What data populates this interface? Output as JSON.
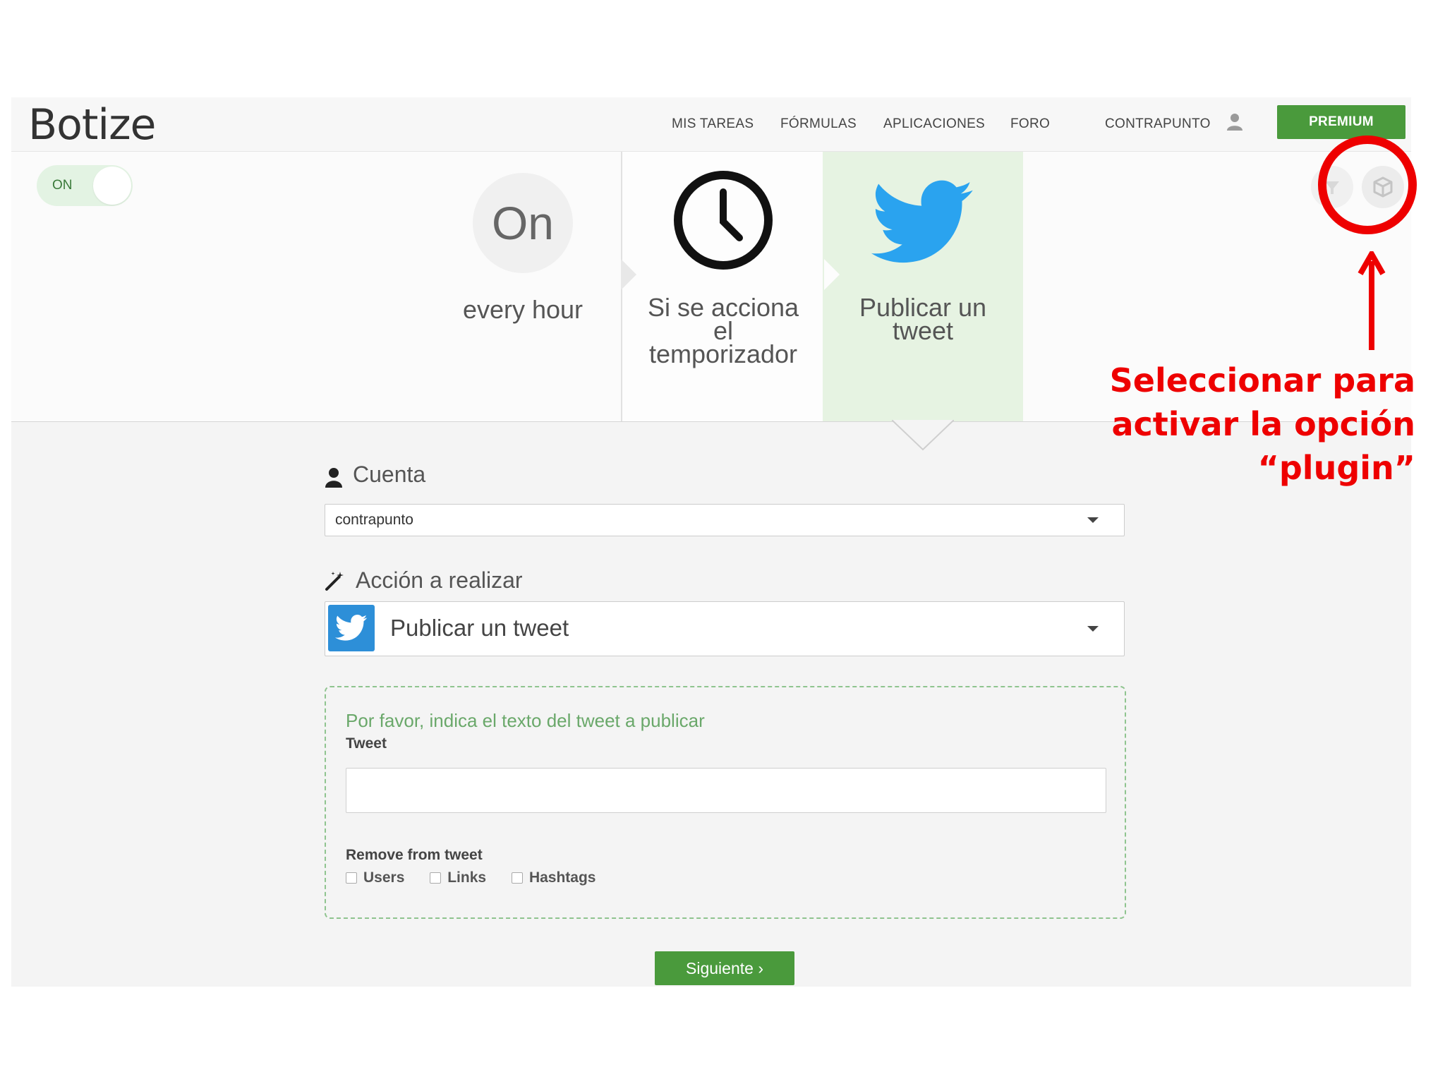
{
  "app": {
    "logo": "Botize"
  },
  "nav": {
    "items": [
      "MIS TAREAS",
      "FÓRMULAS",
      "APLICACIONES",
      "FORO"
    ],
    "user": "CONTRAPUNTO",
    "premium": "PREMIUM"
  },
  "toggle": {
    "label": "ON"
  },
  "steps": {
    "trigger_circle": "On",
    "trigger_text": "every hour",
    "condition_text": "Si se acciona el temporizador",
    "action_text": "Publicar un tweet"
  },
  "form": {
    "account_label": "Cuenta",
    "account_value": "contrapunto",
    "action_label": "Acción a realizar",
    "action_value": "Publicar un tweet",
    "hint": "Por favor, indica el texto del tweet a publicar",
    "tweet_label": "Tweet",
    "tweet_value": "",
    "remove_label": "Remove from tweet",
    "remove_options": [
      "Users",
      "Links",
      "Hashtags"
    ],
    "next": "Siguiente ›"
  },
  "annotation": {
    "line1": "Seleccionar para",
    "line2": "activar la opción",
    "line3": "“plugin”"
  },
  "colors": {
    "accent_green": "#4a9a3c",
    "twitter_blue": "#2aa3ef",
    "annotation_red": "#ee0000"
  }
}
